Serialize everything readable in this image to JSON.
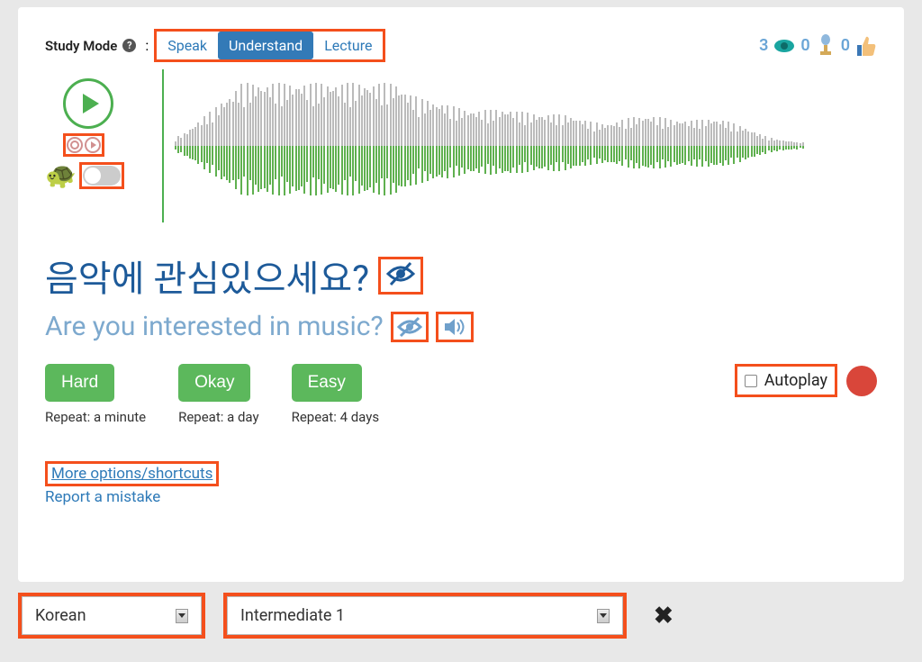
{
  "header": {
    "study_mode_label": "Study Mode",
    "tabs": [
      "Speak",
      "Understand",
      "Lecture"
    ],
    "active_tab_index": 1,
    "stats": {
      "views": 3,
      "recordings": 0,
      "likes": 0
    }
  },
  "playback": {
    "slow_toggle_on": false
  },
  "sentence": {
    "target_text": "음악에 관심있으세요?",
    "translation_text": "Are you interested in music?"
  },
  "difficulty": {
    "buttons": [
      {
        "label": "Hard",
        "repeat": "Repeat: a minute"
      },
      {
        "label": "Okay",
        "repeat": "Repeat: a day"
      },
      {
        "label": "Easy",
        "repeat": "Repeat: 4 days"
      }
    ],
    "autoplay_label": "Autoplay",
    "autoplay_checked": false
  },
  "links": {
    "more_options": "More options/shortcuts",
    "report": "Report a mistake"
  },
  "bottom": {
    "language": "Korean",
    "level": "Intermediate 1"
  }
}
